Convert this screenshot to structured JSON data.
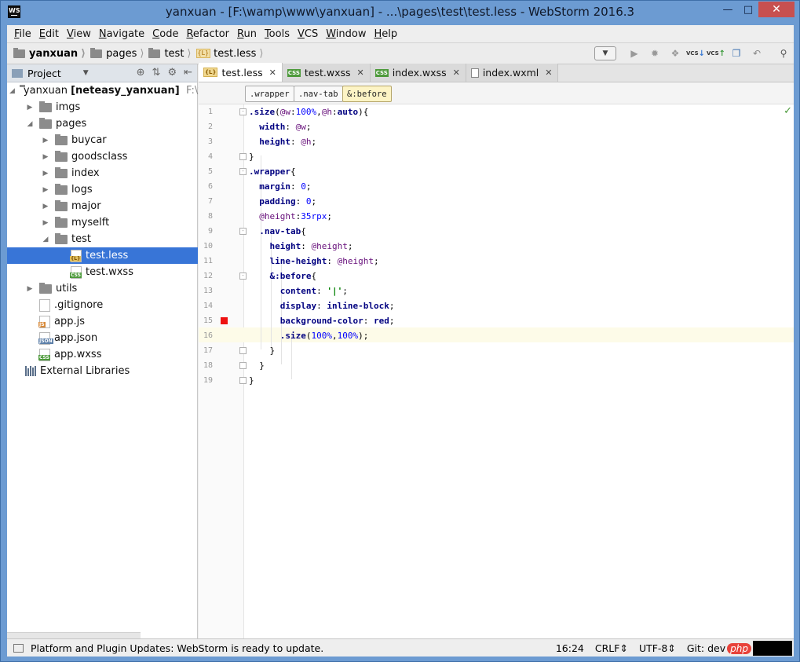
{
  "window": {
    "title": "yanxuan - [F:\\wamp\\www\\yanxuan] - ...\\pages\\test\\test.less - WebStorm 2016.3",
    "app_icon": "WS"
  },
  "menu": [
    "File",
    "Edit",
    "View",
    "Navigate",
    "Code",
    "Refactor",
    "Run",
    "Tools",
    "VCS",
    "Window",
    "Help"
  ],
  "menu_mnemonics": [
    "F",
    "E",
    "V",
    "N",
    "C",
    "R",
    "R",
    "T",
    "V",
    "W",
    "H"
  ],
  "breadcrumbs": [
    "yanxuan",
    "pages",
    "test",
    "test.less"
  ],
  "project_panel": {
    "label": "Project",
    "root": "yanxuan",
    "root_module": "[neteasy_yanxuan]",
    "root_path": "F:\\wa",
    "items": [
      {
        "label": "imgs",
        "type": "folder",
        "depth": 1,
        "arrow": "collapsed"
      },
      {
        "label": "pages",
        "type": "folder",
        "depth": 1,
        "arrow": "expanded"
      },
      {
        "label": "buycar",
        "type": "folder",
        "depth": 2,
        "arrow": "collapsed"
      },
      {
        "label": "goodsclass",
        "type": "folder",
        "depth": 2,
        "arrow": "collapsed"
      },
      {
        "label": "index",
        "type": "folder",
        "depth": 2,
        "arrow": "collapsed"
      },
      {
        "label": "logs",
        "type": "folder",
        "depth": 2,
        "arrow": "collapsed"
      },
      {
        "label": "major",
        "type": "folder",
        "depth": 2,
        "arrow": "collapsed"
      },
      {
        "label": "myselft",
        "type": "folder",
        "depth": 2,
        "arrow": "collapsed"
      },
      {
        "label": "test",
        "type": "folder",
        "depth": 2,
        "arrow": "expanded"
      },
      {
        "label": "test.less",
        "type": "less",
        "depth": 3,
        "arrow": "none",
        "selected": true
      },
      {
        "label": "test.wxss",
        "type": "css",
        "depth": 3,
        "arrow": "none"
      },
      {
        "label": "utils",
        "type": "folder",
        "depth": 1,
        "arrow": "collapsed"
      },
      {
        "label": ".gitignore",
        "type": "git",
        "depth": 1,
        "arrow": "none"
      },
      {
        "label": "app.js",
        "type": "js",
        "depth": 1,
        "arrow": "none"
      },
      {
        "label": "app.json",
        "type": "json",
        "depth": 1,
        "arrow": "none"
      },
      {
        "label": "app.wxss",
        "type": "css",
        "depth": 1,
        "arrow": "none"
      }
    ],
    "external": "External Libraries"
  },
  "tabs": [
    {
      "label": "test.less",
      "icon": "less",
      "active": true
    },
    {
      "label": "test.wxss",
      "icon": "css"
    },
    {
      "label": "index.wxss",
      "icon": "css"
    },
    {
      "label": "index.wxml",
      "icon": "xml"
    }
  ],
  "structure_crumbs": [
    ".wrapper",
    ".nav-tab",
    "&:before"
  ],
  "code_lines": [
    ".size(@w:100%,@h:auto){",
    "  width: @w;",
    "  height: @h;",
    "}",
    ".wrapper{",
    "  margin: 0;",
    "  padding: 0;",
    "  @height:35rpx;",
    "  .nav-tab{",
    "    height: @height;",
    "    line-height: @height;",
    "    &:before{",
    "      content: '|';",
    "      display: inline-block;",
    "      background-color: red;",
    "      .size(100%,100%);",
    "    }",
    "  }",
    "}"
  ],
  "status": {
    "message": "Platform and Plugin Updates: WebStorm is ready to update.",
    "position": "16:24",
    "line_sep": "CRLF",
    "encoding": "UTF-8",
    "vcs": "Git: dev",
    "watermark": "php"
  },
  "colors": {
    "selection": "#3875d7",
    "titlebar": "#6c9bd2",
    "keyword": "#000080",
    "variable": "#660e7a",
    "number": "#0000ff"
  }
}
